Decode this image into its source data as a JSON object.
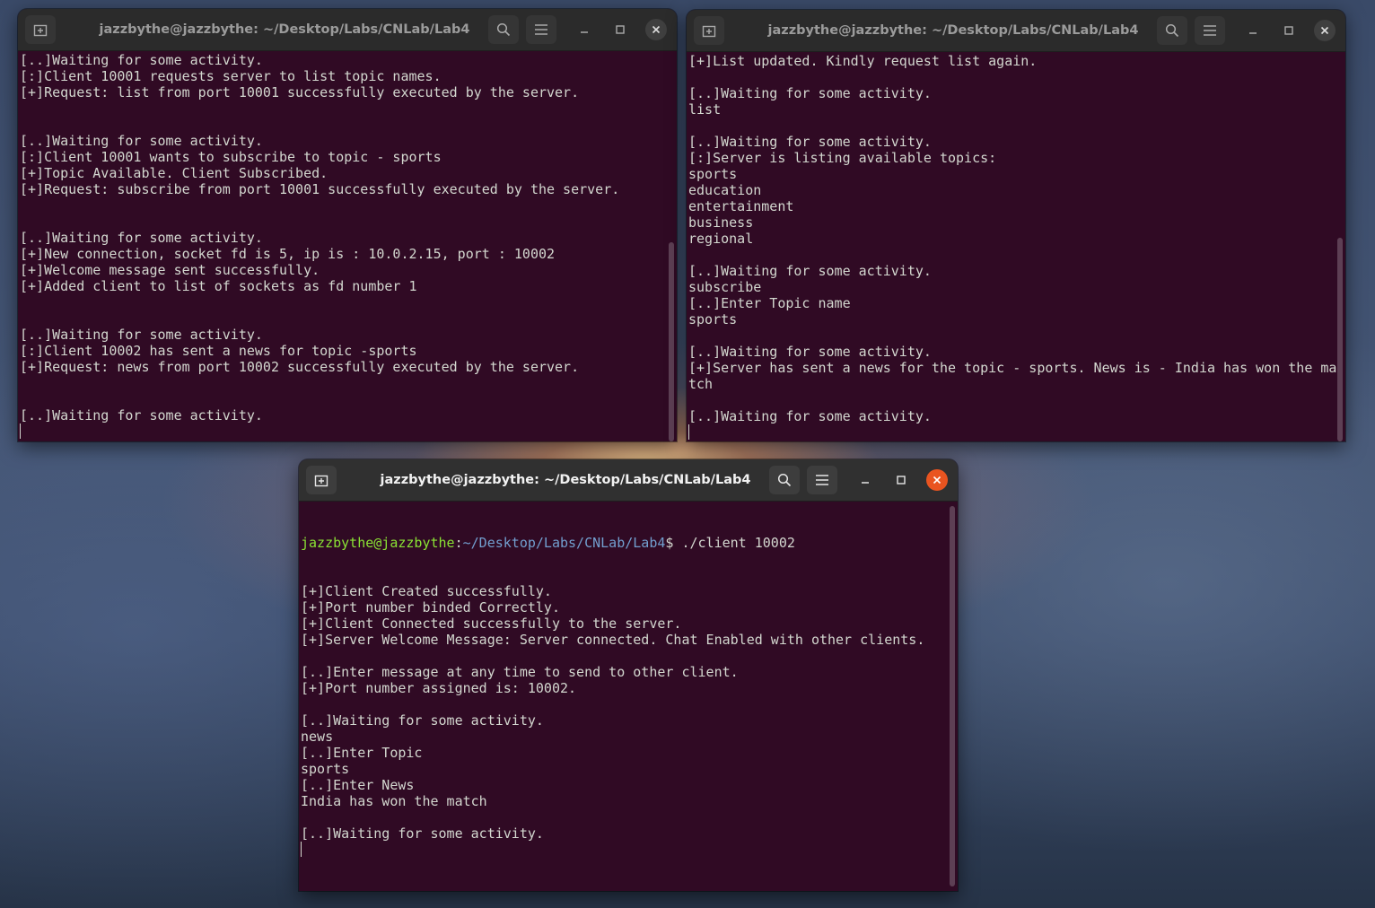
{
  "windows": {
    "server": {
      "title": "jazzbythe@jazzbythe: ~/Desktop/Labs/CNLab/Lab4",
      "lines": [
        "[..]Waiting for some activity.",
        "[:]Client 10001 requests server to list topic names.",
        "[+]Request: list from port 10001 successfully executed by the server.",
        "",
        "",
        "[..]Waiting for some activity.",
        "[:]Client 10001 wants to subscribe to topic - sports",
        "[+]Topic Available. Client Subscribed.",
        "[+]Request: subscribe from port 10001 successfully executed by the server.",
        "",
        "",
        "[..]Waiting for some activity.",
        "[+]New connection, socket fd is 5, ip is : 10.0.2.15, port : 10002",
        "[+]Welcome message sent successfully.",
        "[+]Added client to list of sockets as fd number 1",
        "",
        "",
        "[..]Waiting for some activity.",
        "[:]Client 10002 has sent a news for topic -sports",
        "[+]Request: news from port 10002 successfully executed by the server.",
        "",
        "",
        "[..]Waiting for some activity."
      ]
    },
    "client1": {
      "title": "jazzbythe@jazzbythe: ~/Desktop/Labs/CNLab/Lab4",
      "lines": [
        "[+]List updated. Kindly request list again.",
        "",
        "[..]Waiting for some activity.",
        "list",
        "",
        "[..]Waiting for some activity.",
        "[:]Server is listing available topics:",
        "sports",
        "education",
        "entertainment",
        "business",
        "regional",
        "",
        "[..]Waiting for some activity.",
        "subscribe",
        "[..]Enter Topic name",
        "sports",
        "",
        "[..]Waiting for some activity.",
        "[+]Server has sent a news for the topic - sports. News is - India has won the ma",
        "tch",
        "",
        "[..]Waiting for some activity."
      ]
    },
    "client2": {
      "title": "jazzbythe@jazzbythe: ~/Desktop/Labs/CNLab/Lab4",
      "prompt": {
        "user": "jazzbythe@jazzbythe",
        "sep": ":",
        "path": "~/Desktop/Labs/CNLab/Lab4",
        "tail": "$ ./client 10002"
      },
      "lines": [
        "[+]Client Created successfully.",
        "[+]Port number binded Correctly.",
        "[+]Client Connected successfully to the server.",
        "[+]Server Welcome Message: Server connected. Chat Enabled with other clients.",
        "",
        "[..]Enter message at any time to send to other client.",
        "[+]Port number assigned is: 10002.",
        "",
        "[..]Waiting for some activity.",
        "news",
        "[..]Enter Topic",
        "sports",
        "[..]Enter News",
        "India has won the match",
        "",
        "[..]Waiting for some activity."
      ]
    }
  },
  "icons": {
    "new_tab": "new-tab-icon",
    "search": "search-icon",
    "menu": "hamburger-menu-icon",
    "minimize": "minimize-icon",
    "maximize": "maximize-icon",
    "close": "close-icon"
  },
  "colors": {
    "terminal_bg": "#300a24",
    "terminal_fg": "#d3d7cf",
    "prompt_user": "#8ae234",
    "prompt_path": "#729fcf",
    "close_active": "#e95420"
  }
}
